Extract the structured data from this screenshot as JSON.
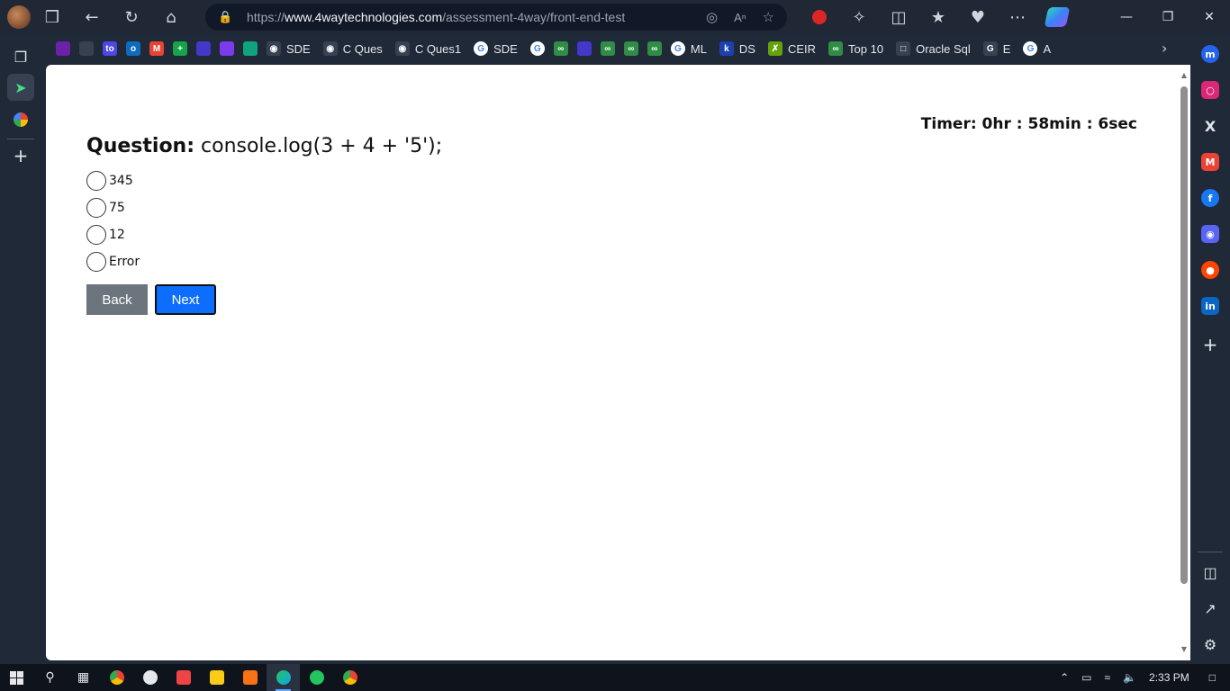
{
  "browser": {
    "url_prefix": "https://",
    "url_domain": "www.4waytechnologies.com",
    "url_path": "/assessment-4way/front-end-test"
  },
  "bookmarks": [
    {
      "label": "",
      "icon": "purple-app-icon",
      "color": "#6b21a8"
    },
    {
      "label": "",
      "icon": "compass-icon",
      "color": "#374151"
    },
    {
      "label": "",
      "icon": "to-icon",
      "color": "#4f46e5"
    },
    {
      "label": "",
      "icon": "outlook-icon",
      "color": "#0f6cbd"
    },
    {
      "label": "",
      "icon": "gmail-icon",
      "color": "#ea4335"
    },
    {
      "label": "",
      "icon": "sheets-icon",
      "color": "#16a34a"
    },
    {
      "label": "",
      "icon": "link-icon",
      "color": "#4338ca"
    },
    {
      "label": "",
      "icon": "flag-icon",
      "color": "#7c3aed"
    },
    {
      "label": "",
      "icon": "openai-icon",
      "color": "#10a37f"
    },
    {
      "label": "SDE",
      "icon": "github-icon",
      "color": "#374151"
    },
    {
      "label": "C Ques",
      "icon": "github-icon",
      "color": "#374151"
    },
    {
      "label": "C Ques1",
      "icon": "github-icon",
      "color": "#374151"
    },
    {
      "label": "SDE",
      "icon": "google-icon",
      "color": "#ffffff"
    },
    {
      "label": "",
      "icon": "google-icon",
      "color": "#ffffff"
    },
    {
      "label": "",
      "icon": "gfg-icon",
      "color": "#2f8d46"
    },
    {
      "label": "",
      "icon": "leetcode-icon",
      "color": "#4338ca"
    },
    {
      "label": "",
      "icon": "gfg-icon",
      "color": "#2f8d46"
    },
    {
      "label": "",
      "icon": "gfg-icon",
      "color": "#2f8d46"
    },
    {
      "label": "",
      "icon": "gfg-icon",
      "color": "#2f8d46"
    },
    {
      "label": "ML",
      "icon": "google-icon",
      "color": "#ffffff"
    },
    {
      "label": "DS",
      "icon": "k-icon",
      "color": "#1e40af"
    },
    {
      "label": "CEIR",
      "icon": "ceir-icon",
      "color": "#65a30d"
    },
    {
      "label": "Top 10",
      "icon": "gfg-icon",
      "color": "#2f8d46"
    },
    {
      "label": "Oracle Sql",
      "icon": "page-icon",
      "color": "#374151"
    },
    {
      "label": "E",
      "icon": "g-icon",
      "color": "#374151"
    },
    {
      "label": "A",
      "icon": "google-icon",
      "color": "#ffffff"
    }
  ],
  "quiz": {
    "timer": "Timer: 0hr : 58min : 6sec",
    "question_label": "Question:",
    "question_text": "console.log(3 + 4 + '5');",
    "options": [
      "345",
      "75",
      "12",
      "Error"
    ],
    "back_label": "Back",
    "next_label": "Next"
  },
  "taskbar": {
    "time": "2:33 PM"
  }
}
